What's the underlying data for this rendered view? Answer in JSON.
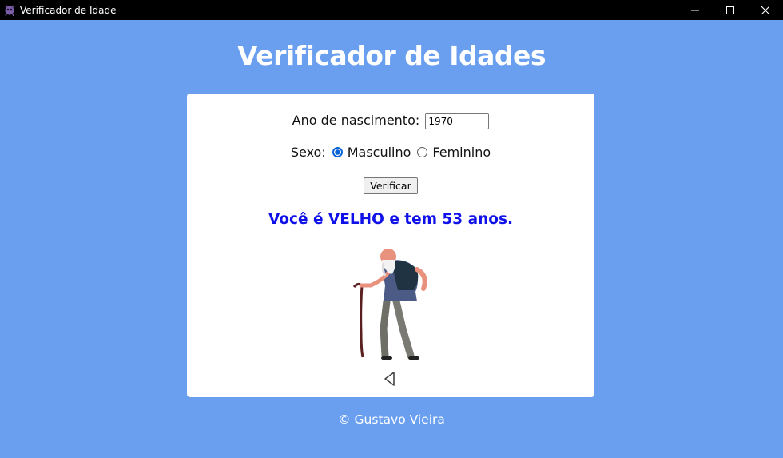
{
  "window": {
    "title": "Verificador de Idade",
    "icons": [
      "app-icon",
      "minimize-icon",
      "maximize-icon",
      "close-icon"
    ]
  },
  "page": {
    "title": "Verificador de Idades",
    "footer": "© Gustavo Vieira"
  },
  "form": {
    "year_label": "Ano de nascimento:",
    "year_value": "1970",
    "sex_label": "Sexo:",
    "options": [
      {
        "label": "Masculino",
        "selected": true
      },
      {
        "label": "Feminino",
        "selected": false
      }
    ],
    "verify_button": "Verificar"
  },
  "result": {
    "text": "Você é VELHO e tem 53 anos.",
    "color": "#1010e8"
  },
  "colors": {
    "background": "#6a9ff0",
    "card": "#ffffff"
  },
  "icons": {
    "illustration": "old-man-with-cane-illustration",
    "back": "triangle-left-icon"
  }
}
